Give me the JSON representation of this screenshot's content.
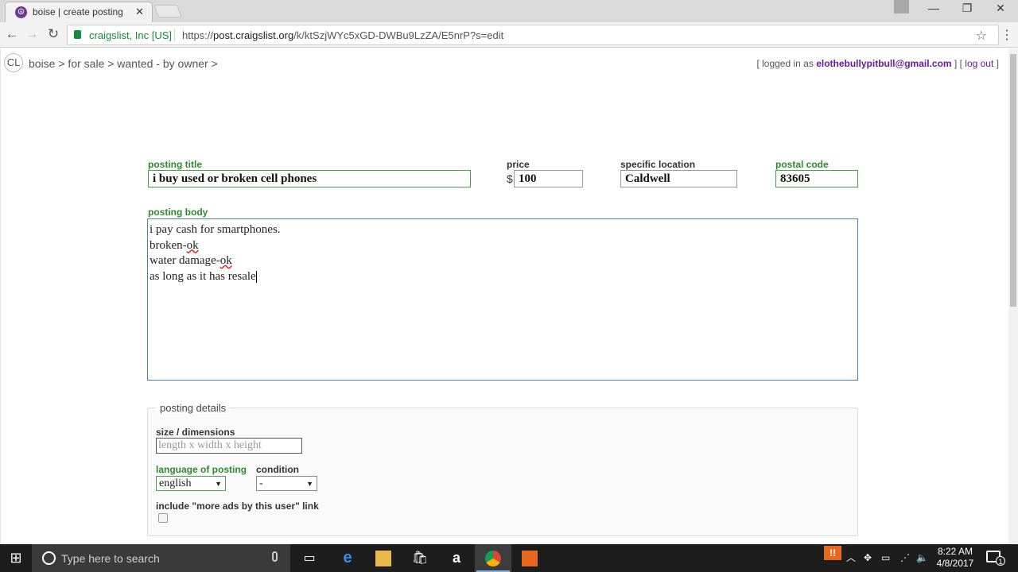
{
  "browser": {
    "tab_title": "boise | create posting",
    "tab_favicon": "peace-icon",
    "secure_label": "craigslist, Inc [US]",
    "url_prefix": "https://",
    "url_host": "post.craigslist.org",
    "url_path": "/k/ktSzjWYc5xGD-DWBu9LzZA/E5nrP?s=edit"
  },
  "page": {
    "logo": "CL",
    "breadcrumb": "boise > for sale > wanted - by owner >",
    "login_prefix": "[ logged in as",
    "login_email": "elothebullypitbull@gmail.com",
    "login_mid": "] [",
    "logout_label": "log out",
    "login_suffix": "]"
  },
  "form": {
    "title_label": "posting title",
    "title_value": "i buy used or broken cell phones",
    "price_label": "price",
    "price_currency": "$",
    "price_value": "100",
    "location_label": "specific location",
    "location_value": "Caldwell",
    "postal_label": "postal code",
    "postal_value": "83605",
    "body_label": "posting body",
    "body_lines": {
      "l1": "i pay cash for smartphones.",
      "l2a": "broken-",
      "l2b": "ok",
      "l3a": "water damage-",
      "l3b": "ok",
      "l4": "as long as it has resale"
    }
  },
  "details": {
    "legend": "posting details",
    "size_label": "size / dimensions",
    "size_placeholder": "length x width x height",
    "language_label": "language of posting",
    "language_value": "english",
    "condition_label": "condition",
    "condition_value": "-",
    "more_ads_label": "include \"more ads by this user\" link"
  },
  "taskbar": {
    "search_placeholder": "Type here to search",
    "time": "8:22 AM",
    "date": "4/8/2017",
    "notification_count": "1"
  }
}
